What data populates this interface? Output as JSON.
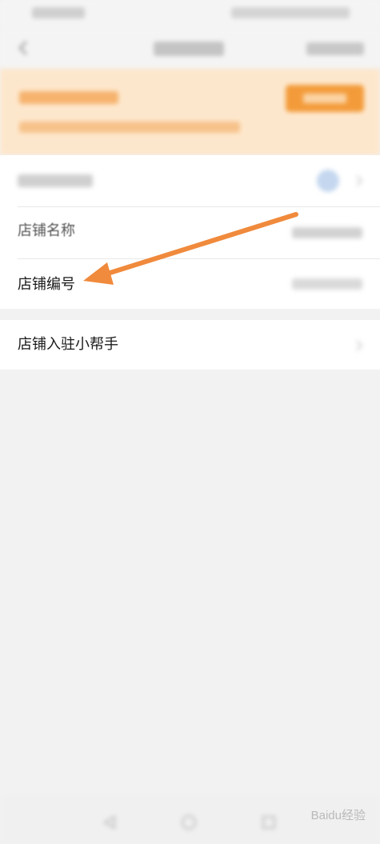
{
  "rows": {
    "store_name_label": "店铺名称",
    "store_number_label": "店铺编号"
  },
  "helper": {
    "label": "店铺入驻小帮手"
  },
  "watermark": "Baidu经验",
  "colors": {
    "arrow": "#f08a3c",
    "banner_bg": "#fde7cc",
    "banner_button": "#f39b3a",
    "page_bg": "#f2f2f2"
  },
  "icons": {
    "back": "back-icon",
    "chevron": "chevron-right-icon",
    "nav_back": "triangle-back-icon",
    "nav_home": "circle-home-icon",
    "nav_recent": "square-recent-icon"
  }
}
